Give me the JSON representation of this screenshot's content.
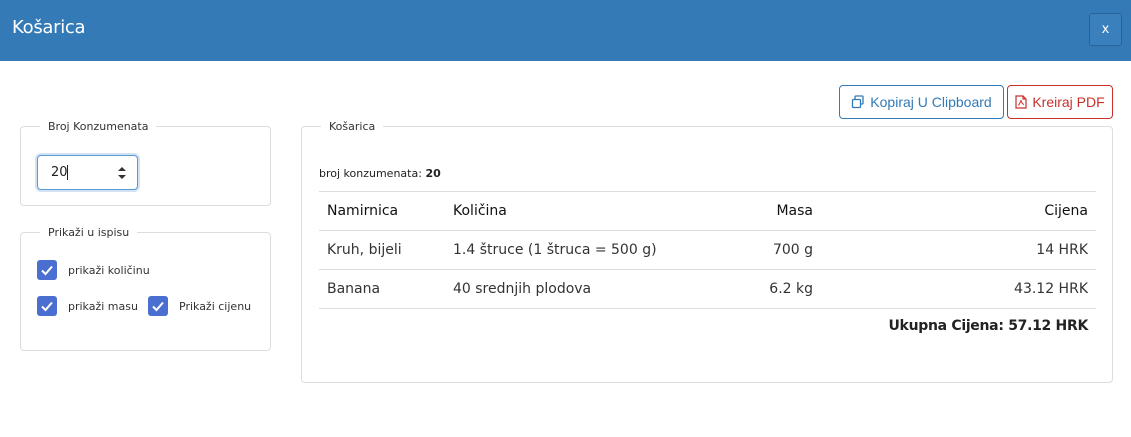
{
  "header": {
    "title": "Košarica",
    "close_label": "x"
  },
  "toolbar": {
    "copy_label": "Kopiraj U Clipboard",
    "pdf_label": "Kreiraj PDF"
  },
  "consumers": {
    "legend": "Broj Konzumenata",
    "value": "20"
  },
  "print_options": {
    "legend": "Prikaži u ispisu",
    "show_quantity": {
      "label": "prikaži količinu",
      "checked": true
    },
    "show_mass": {
      "label": "prikaži masu",
      "checked": true
    },
    "show_price": {
      "label": "Prikaži cijenu",
      "checked": true
    }
  },
  "cart": {
    "legend": "Košarica",
    "consumers_label": "broj konzumenata:",
    "consumers_value": "20",
    "columns": {
      "item": "Namirnica",
      "quantity": "Količina",
      "mass": "Masa",
      "price": "Cijena"
    },
    "rows": [
      {
        "item": "Kruh, bijeli",
        "quantity": "1.4 štruce (1 štruca = 500 g)",
        "mass": "700 g",
        "price": "14 HRK"
      },
      {
        "item": "Banana",
        "quantity": "40 srednjih plodova",
        "mass": "6.2 kg",
        "price": "43.12 HRK"
      }
    ],
    "total": "Ukupna Cijena: 57.12 HRK"
  },
  "colors": {
    "header": "#337ab7",
    "checkbox": "#4b6fd1",
    "pdf": "#c9302c"
  }
}
